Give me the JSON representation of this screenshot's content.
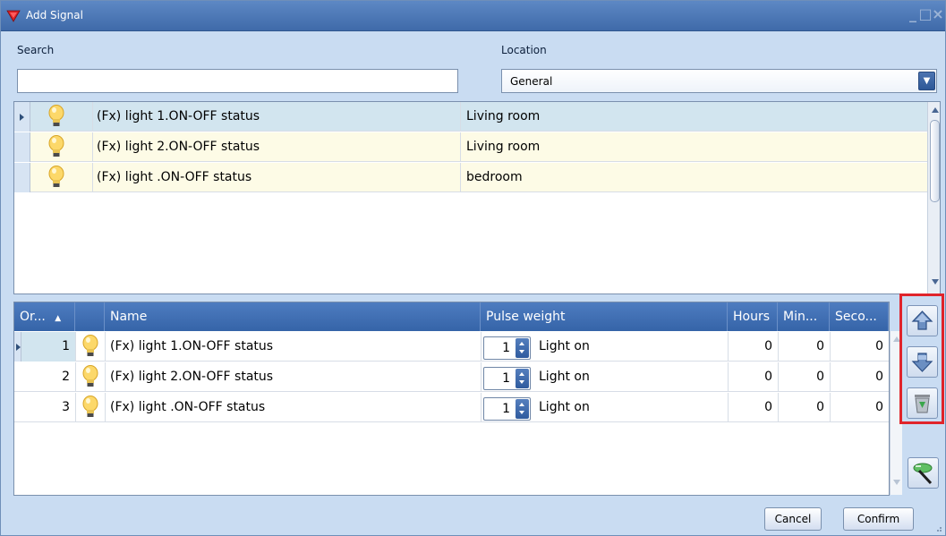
{
  "window": {
    "title": "Add Signal"
  },
  "search": {
    "label": "Search",
    "value": "",
    "placeholder": ""
  },
  "location": {
    "label": "Location",
    "selected": "General"
  },
  "signals": [
    {
      "name": "(Fx) light 1.ON-OFF status",
      "location": "Living room",
      "icon": "light-bulb-icon"
    },
    {
      "name": "(Fx) light 2.ON-OFF status",
      "location": "Living room",
      "icon": "light-bulb-icon"
    },
    {
      "name": "(Fx) light .ON-OFF status",
      "location": "bedroom",
      "icon": "light-bulb-icon"
    }
  ],
  "selected_table": {
    "columns": {
      "order": "Or...",
      "name": "Name",
      "pulse_weight": "Pulse weight",
      "hours": "Hours",
      "minutes": "Min...",
      "seconds": "Seco..."
    },
    "rows": [
      {
        "order": "1",
        "name": "(Fx) light 1.ON-OFF status",
        "pulse_value": "1",
        "pulse_label": "Light on",
        "hours": "0",
        "minutes": "0",
        "seconds": "0"
      },
      {
        "order": "2",
        "name": "(Fx) light 2.ON-OFF status",
        "pulse_value": "1",
        "pulse_label": "Light on",
        "hours": "0",
        "minutes": "0",
        "seconds": "0"
      },
      {
        "order": "3",
        "name": "(Fx) light .ON-OFF status",
        "pulse_value": "1",
        "pulse_label": "Light on",
        "hours": "0",
        "minutes": "0",
        "seconds": "0"
      }
    ]
  },
  "toolbar": {
    "move_up_icon": "arrow-up-icon",
    "move_down_icon": "arrow-down-icon",
    "delete_icon": "recycle-bin-icon",
    "edit_icon": "edit-tool-icon"
  },
  "buttons": {
    "cancel": "Cancel",
    "confirm": "Confirm"
  },
  "colors": {
    "selected_row": "#d2e5ef",
    "alt_row": "#fdfbe6",
    "header": "#3f6eb2",
    "highlight_border": "#e0242b"
  }
}
